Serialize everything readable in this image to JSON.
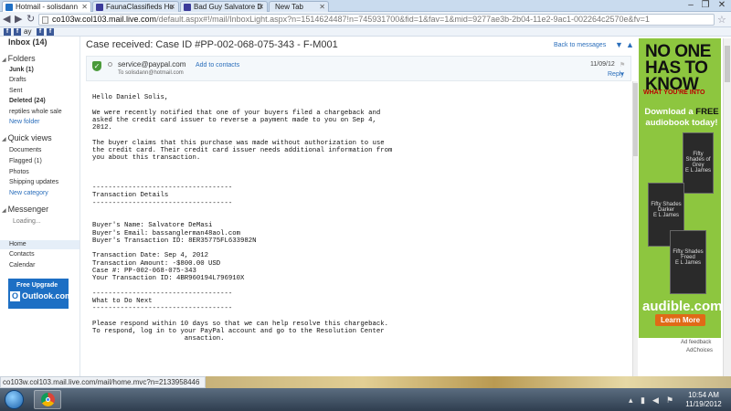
{
  "browser": {
    "tabs": [
      {
        "label": "Hotmail - solisdann",
        "active": true,
        "color": "#1f6fc4"
      },
      {
        "label": "FaunaClassifieds Ho",
        "active": false,
        "color": "#3b3b9a"
      },
      {
        "label": "Bad Guy Salvatore D",
        "active": false,
        "color": "#3b3b9a"
      },
      {
        "label": "New Tab",
        "active": false,
        "color": ""
      }
    ],
    "url_host": "co103w.col103.mail.live.com",
    "url_rest": "/default.aspx#!/mail/InboxLight.aspx?n=1514624487!n=745931700&fid=1&fav=1&mid=9277ae3b-2b04-11e2-9ac1-002264c2570e&fv=1",
    "bookmarks": [
      "f",
      "f",
      "ay",
      "f",
      "f"
    ]
  },
  "sidebar": {
    "inbox": "Inbox (14)",
    "folders_title": "Folders",
    "folders": [
      {
        "label": "Junk (1)",
        "bold": true
      },
      {
        "label": "Drafts",
        "bold": false
      },
      {
        "label": "Sent",
        "bold": false
      },
      {
        "label": "Deleted (24)",
        "bold": true
      },
      {
        "label": "reptiles whole sale",
        "bold": false
      },
      {
        "label": "New folder",
        "link": true
      }
    ],
    "quickviews_title": "Quick views",
    "quickviews": [
      {
        "label": "Documents"
      },
      {
        "label": "Flagged (1)"
      },
      {
        "label": "Photos"
      },
      {
        "label": "Shipping updates"
      },
      {
        "label": "New category",
        "link": true
      }
    ],
    "messenger_title": "Messenger",
    "messenger_status": "Loading...",
    "bottom": [
      {
        "label": "Home",
        "selected": true
      },
      {
        "label": "Contacts"
      },
      {
        "label": "Calendar"
      }
    ],
    "upgrade": {
      "line1": "Free Upgrade",
      "line2": "Outlook.com"
    }
  },
  "message": {
    "subject": "Case received: Case ID #PP-002-068-075-343 - F-M001",
    "back_link": "Back to messages",
    "sender": "service@paypal.com",
    "add_contact": "Add to contacts",
    "to": "To solisdann@hotmail.com",
    "date": "11/09/12",
    "reply": "Reply",
    "body_lines": [
      "Hello Daniel Solis,",
      "",
      "We were recently notified that one of your buyers filed a chargeback and",
      "asked the credit card issuer to reverse a payment made to you on Sep 4,",
      "2012.",
      "",
      "The buyer claims that this purchase was made without authorization to use",
      "the credit card. Their credit card issuer needs additional information from",
      "you about this transaction.",
      "",
      "",
      "",
      "-----------------------------------",
      "Transaction Details",
      "-----------------------------------",
      "",
      "",
      "Buyer's Name: Salvatore DeMasi",
      "Buyer's Email: bassanglerman48aol.com",
      "Buyer's Transaction ID: 8ER35775FL633982N",
      "",
      "Transaction Date: Sep 4, 2012",
      "Transaction Amount: -$800.00 USD",
      "Case #: PP-002-068-075-343",
      "Your Transaction ID: 4BR960194L796910X",
      "",
      "-----------------------------------",
      "What to Do Next",
      "-----------------------------------",
      "",
      "Please respond within 10 days so that we can help resolve this chargeback.",
      "To respond, log in to your PayPal account and go to the Resolution Center",
      "                       ansaction."
    ]
  },
  "ad": {
    "headline": "NO ONE HAS TO KNOW",
    "tagline": "WHAT YOU'RE INTO",
    "offer_pre": "Download a",
    "offer_free": "FREE",
    "offer_post": "audiobook today!",
    "books": [
      {
        "title": "Fifty Shades of Grey",
        "author": "E L James"
      },
      {
        "title": "Fifty Shades Darker",
        "author": "E L James"
      },
      {
        "title": "Fifty Shades Freed",
        "author": "E L James"
      }
    ],
    "brand": "audible.com",
    "cta": "Learn More",
    "feedback": "Ad feedback",
    "adchoices": "AdChoices"
  },
  "status_bar": "co103w.col103.mail.live.com/mail/home.mvc?n=2133958446",
  "taskbar": {
    "time": "10:54 AM",
    "date": "11/19/2012"
  }
}
